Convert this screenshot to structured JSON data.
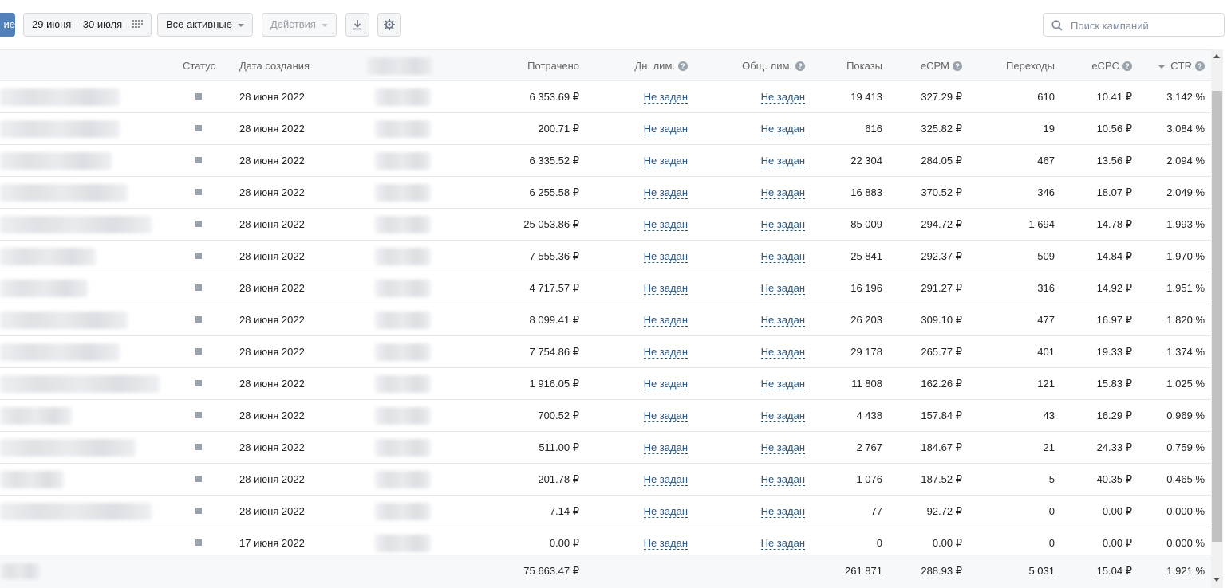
{
  "toolbar": {
    "create_label": "ие",
    "date_range": "29 июня – 30 июля",
    "status_filter": "Все активные",
    "actions_label": "Действия",
    "search_placeholder": "Поиск кампаний",
    "icons": [
      "calendar-icon",
      "download-icon",
      "gear-icon",
      "search-icon"
    ]
  },
  "table": {
    "headers": {
      "status": "Статус",
      "created": "Дата создания",
      "spent": "Потрачено",
      "daily_limit": "Дн. лим.",
      "total_limit": "Общ. лим.",
      "impressions": "Показы",
      "ecpm": "eCPM",
      "clicks": "Переходы",
      "ecpc": "eCPC",
      "ctr": "CTR"
    },
    "help_mark": "?",
    "sorted_column": "ctr",
    "rows": [
      {
        "created": "28 июня 2022",
        "spent": "6 353.69 ₽",
        "daily_limit": "Не задан",
        "total_limit": "Не задан",
        "impressions": "19 413",
        "ecpm": "327.29 ₽",
        "clicks": "610",
        "ecpc": "10.41 ₽",
        "ctr": "3.142 %"
      },
      {
        "created": "28 июня 2022",
        "spent": "200.71 ₽",
        "daily_limit": "Не задан",
        "total_limit": "Не задан",
        "impressions": "616",
        "ecpm": "325.82 ₽",
        "clicks": "19",
        "ecpc": "10.56 ₽",
        "ctr": "3.084 %"
      },
      {
        "created": "28 июня 2022",
        "spent": "6 335.52 ₽",
        "daily_limit": "Не задан",
        "total_limit": "Не задан",
        "impressions": "22 304",
        "ecpm": "284.05 ₽",
        "clicks": "467",
        "ecpc": "13.56 ₽",
        "ctr": "2.094 %"
      },
      {
        "created": "28 июня 2022",
        "spent": "6 255.58 ₽",
        "daily_limit": "Не задан",
        "total_limit": "Не задан",
        "impressions": "16 883",
        "ecpm": "370.52 ₽",
        "clicks": "346",
        "ecpc": "18.07 ₽",
        "ctr": "2.049 %"
      },
      {
        "created": "28 июня 2022",
        "spent": "25 053.86 ₽",
        "daily_limit": "Не задан",
        "total_limit": "Не задан",
        "impressions": "85 009",
        "ecpm": "294.72 ₽",
        "clicks": "1 694",
        "ecpc": "14.78 ₽",
        "ctr": "1.993 %"
      },
      {
        "created": "28 июня 2022",
        "spent": "7 555.36 ₽",
        "daily_limit": "Не задан",
        "total_limit": "Не задан",
        "impressions": "25 841",
        "ecpm": "292.37 ₽",
        "clicks": "509",
        "ecpc": "14.84 ₽",
        "ctr": "1.970 %"
      },
      {
        "created": "28 июня 2022",
        "spent": "4 717.57 ₽",
        "daily_limit": "Не задан",
        "total_limit": "Не задан",
        "impressions": "16 196",
        "ecpm": "291.27 ₽",
        "clicks": "316",
        "ecpc": "14.92 ₽",
        "ctr": "1.951 %"
      },
      {
        "created": "28 июня 2022",
        "spent": "8 099.41 ₽",
        "daily_limit": "Не задан",
        "total_limit": "Не задан",
        "impressions": "26 203",
        "ecpm": "309.10 ₽",
        "clicks": "477",
        "ecpc": "16.97 ₽",
        "ctr": "1.820 %"
      },
      {
        "created": "28 июня 2022",
        "spent": "7 754.86 ₽",
        "daily_limit": "Не задан",
        "total_limit": "Не задан",
        "impressions": "29 178",
        "ecpm": "265.77 ₽",
        "clicks": "401",
        "ecpc": "19.33 ₽",
        "ctr": "1.374 %"
      },
      {
        "created": "28 июня 2022",
        "spent": "1 916.05 ₽",
        "daily_limit": "Не задан",
        "total_limit": "Не задан",
        "impressions": "11 808",
        "ecpm": "162.26 ₽",
        "clicks": "121",
        "ecpc": "15.83 ₽",
        "ctr": "1.025 %"
      },
      {
        "created": "28 июня 2022",
        "spent": "700.52 ₽",
        "daily_limit": "Не задан",
        "total_limit": "Не задан",
        "impressions": "4 438",
        "ecpm": "157.84 ₽",
        "clicks": "43",
        "ecpc": "16.29 ₽",
        "ctr": "0.969 %"
      },
      {
        "created": "28 июня 2022",
        "spent": "511.00 ₽",
        "daily_limit": "Не задан",
        "total_limit": "Не задан",
        "impressions": "2 767",
        "ecpm": "184.67 ₽",
        "clicks": "21",
        "ecpc": "24.33 ₽",
        "ctr": "0.759 %"
      },
      {
        "created": "28 июня 2022",
        "spent": "201.78 ₽",
        "daily_limit": "Не задан",
        "total_limit": "Не задан",
        "impressions": "1 076",
        "ecpm": "187.52 ₽",
        "clicks": "5",
        "ecpc": "40.35 ₽",
        "ctr": "0.465 %"
      },
      {
        "created": "28 июня 2022",
        "spent": "7.14 ₽",
        "daily_limit": "Не задан",
        "total_limit": "Не задан",
        "impressions": "77",
        "ecpm": "92.72 ₽",
        "clicks": "0",
        "ecpc": "0.00 ₽",
        "ctr": "0.000 %"
      },
      {
        "created": "17 июня 2022",
        "spent": "0.00 ₽",
        "daily_limit": "Не задан",
        "total_limit": "Не задан",
        "impressions": "0",
        "ecpm": "0.00 ₽",
        "clicks": "0",
        "ecpc": "0.00 ₽",
        "ctr": "0.000 %"
      }
    ],
    "totals": {
      "spent": "75 663.47 ₽",
      "impressions": "261 871",
      "ecpm": "288.93 ₽",
      "clicks": "5 031",
      "ecpc": "15.04 ₽",
      "ctr": "1.921 %"
    }
  },
  "colors": {
    "accent": "#5181b8",
    "link": "#2a5885",
    "header_bg": "#f7f8fa",
    "status_paused": "#99a2ad"
  }
}
